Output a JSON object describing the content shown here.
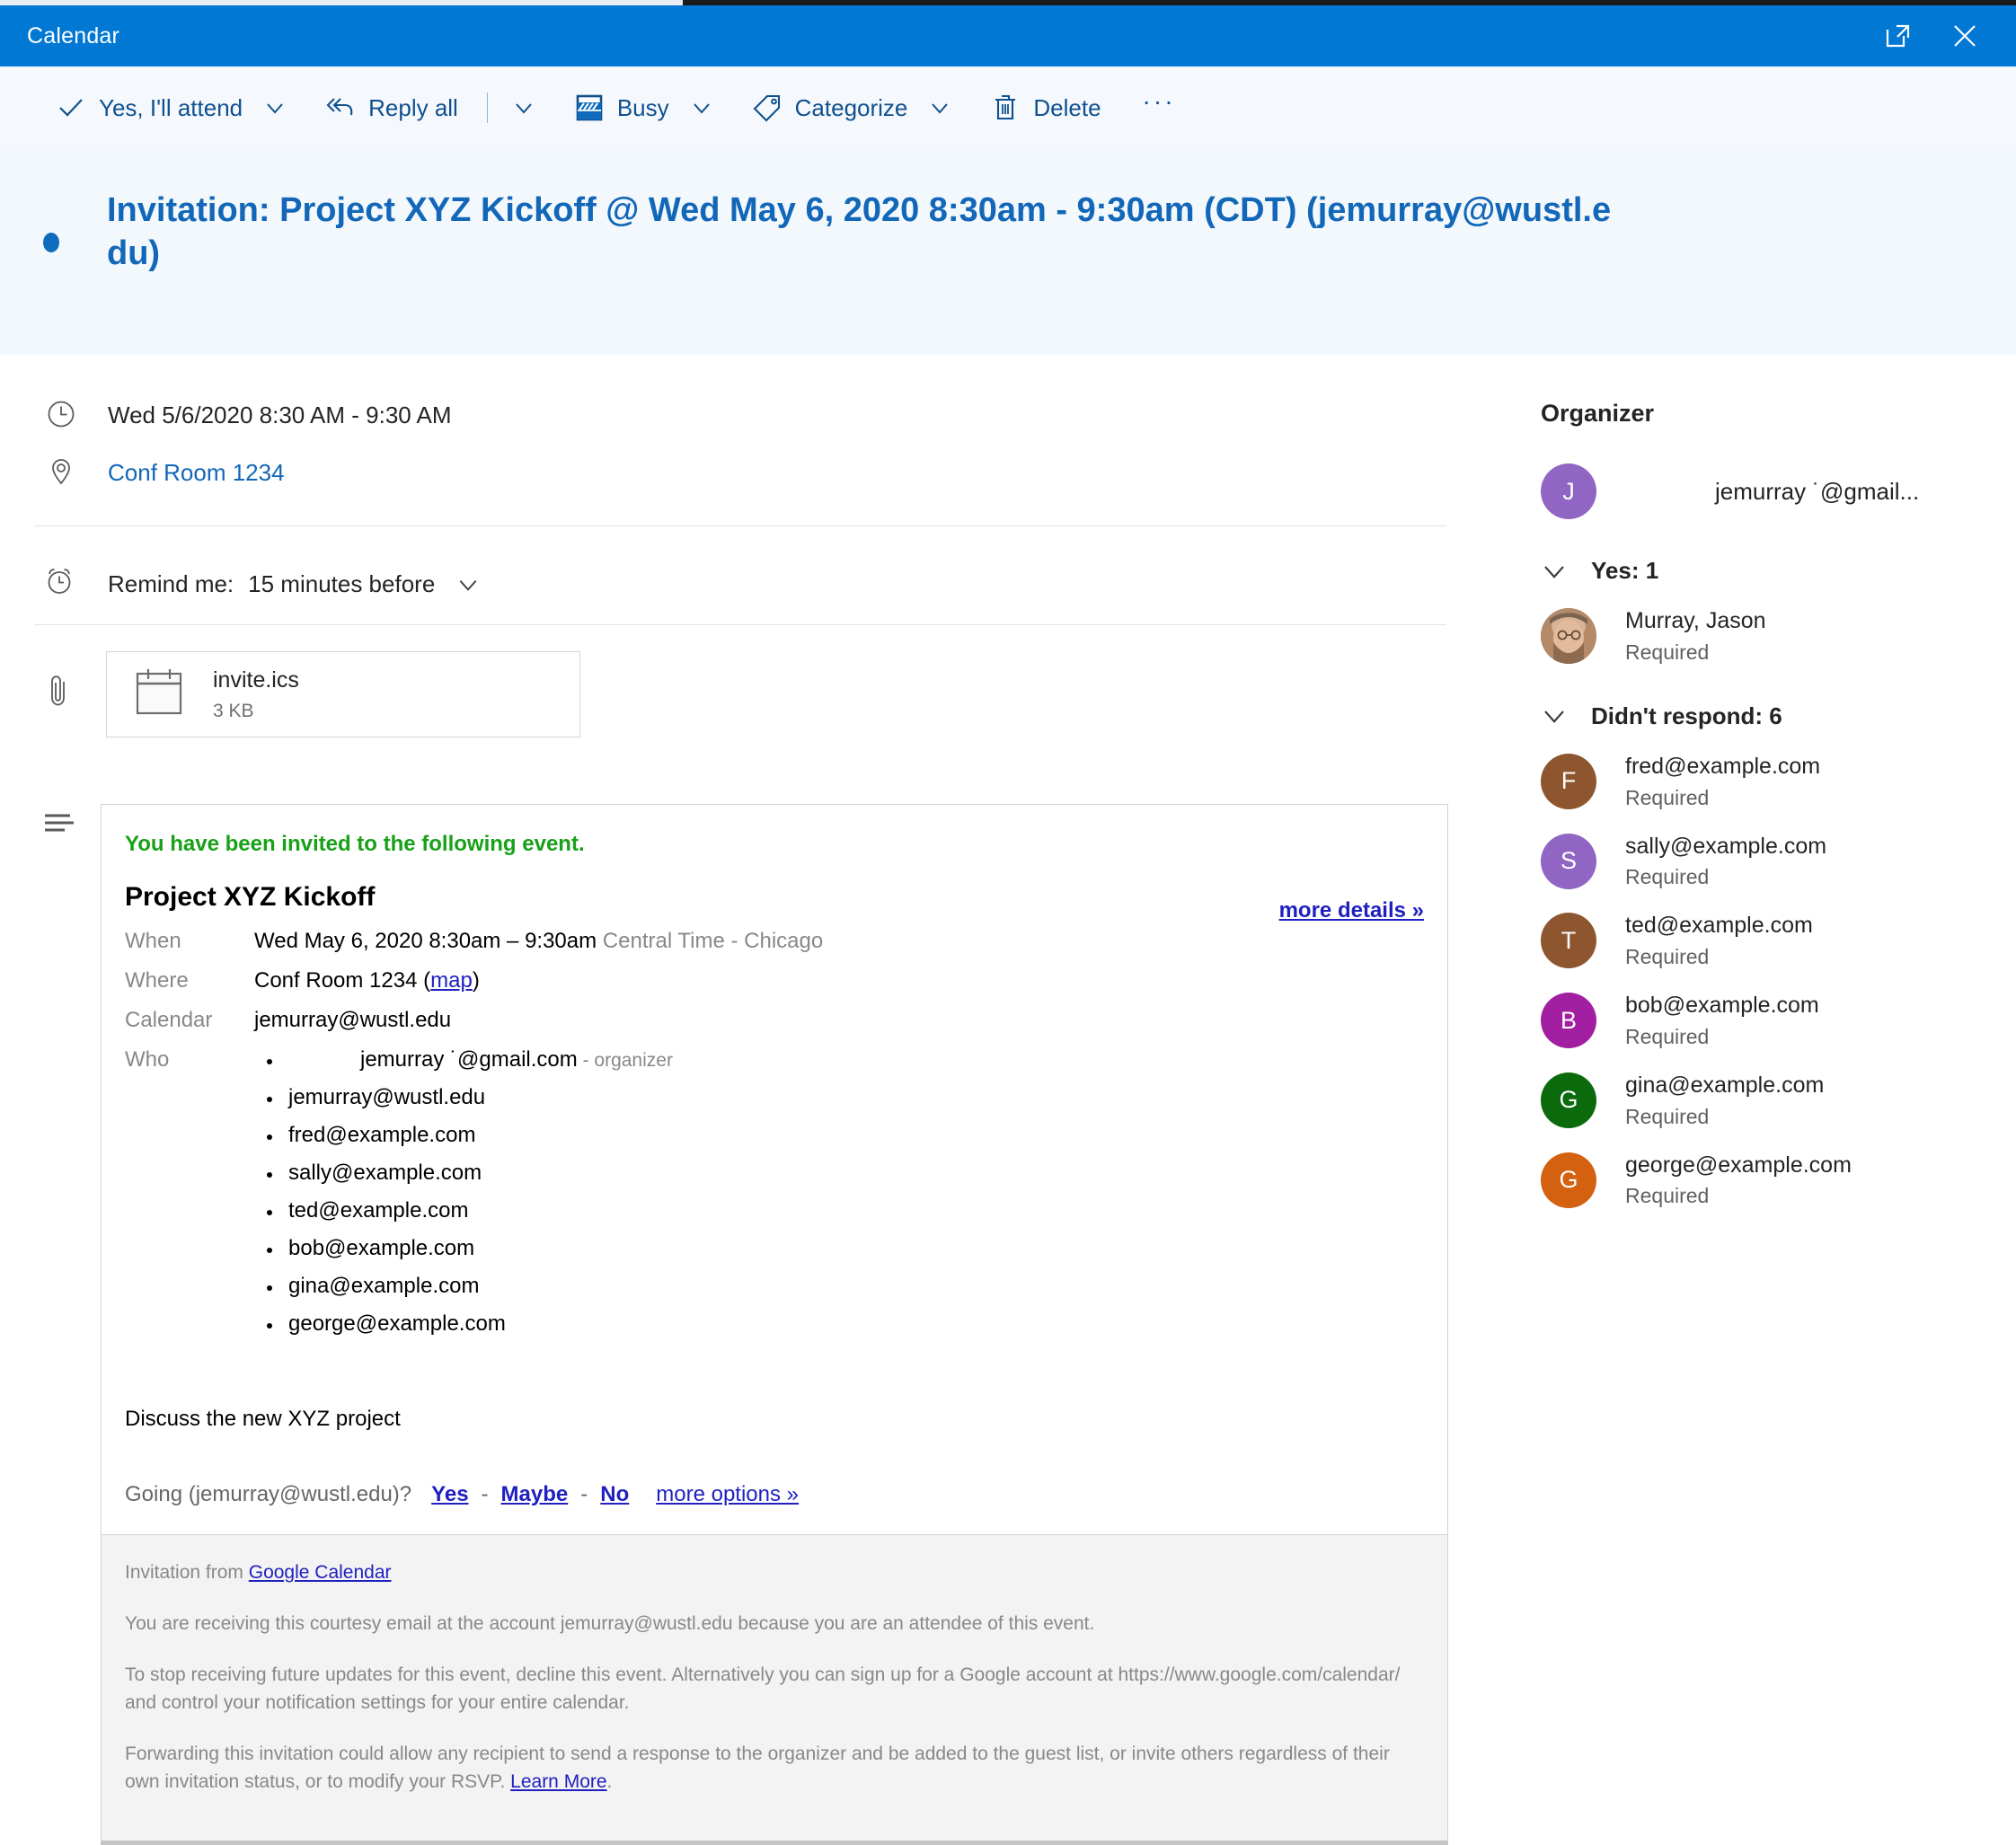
{
  "window": {
    "title": "Calendar",
    "actions": [
      {
        "name": "popout-icon",
        "label": "Open in new window"
      },
      {
        "name": "close-icon",
        "label": "Close"
      }
    ]
  },
  "toolbar": {
    "items": [
      {
        "icon": "checkmark-icon",
        "label": "Yes, I'll attend",
        "caret": true
      },
      {
        "icon": "reply-all-icon",
        "label": "Reply all",
        "caret": true,
        "separator": true
      },
      {
        "icon": "busy-icon",
        "label": "Busy",
        "caret": true
      },
      {
        "icon": "tag-icon",
        "label": "Categorize",
        "caret": true
      },
      {
        "icon": "trash-icon",
        "label": "Delete",
        "caret": false
      }
    ],
    "overflow_label": "···"
  },
  "subject": "Invitation: Project XYZ Kickoff @ Wed May 6, 2020 8:30am - 9:30am (CDT) (jemurray@wustl.edu)",
  "event": {
    "when": "Wed 5/6/2020 8:30 AM - 9:30 AM",
    "where": "Conf Room 1234",
    "reminder_label": "Remind me:",
    "reminder_value": "15 minutes before"
  },
  "attachment": {
    "name": "invite.ics",
    "size": "3 KB",
    "icon": "calendar-file-icon"
  },
  "invitation": {
    "banner": "You have been invited to the following event.",
    "title": "Project XYZ Kickoff",
    "more_details": "more details »",
    "rows": {
      "when_label": "When",
      "when_value": "Wed May 6, 2020 8:30am – 9:30am",
      "when_timezone": "Central Time - Chicago",
      "where_label": "Where",
      "where_value": "Conf Room 1234",
      "where_map": "map",
      "calendar_label": "Calendar",
      "calendar_value": "jemurray@wustl.edu",
      "who_label": "Who"
    },
    "who": [
      {
        "email": "jemurray ˙@gmail.com",
        "tag": "- organizer",
        "organizer": true
      },
      {
        "email": "jemurray@wustl.edu",
        "tag": "",
        "organizer": false
      },
      {
        "email": "fred@example.com",
        "tag": "",
        "organizer": false
      },
      {
        "email": "sally@example.com",
        "tag": "",
        "organizer": false
      },
      {
        "email": "ted@example.com",
        "tag": "",
        "organizer": false
      },
      {
        "email": "bob@example.com",
        "tag": "",
        "organizer": false
      },
      {
        "email": "gina@example.com",
        "tag": "",
        "organizer": false
      },
      {
        "email": "george@example.com",
        "tag": "",
        "organizer": false
      }
    ],
    "description": "Discuss the new XYZ project",
    "rsvp": {
      "prompt": "Going (jemurray@wustl.edu)?",
      "yes": "Yes",
      "maybe": "Maybe",
      "no": "No",
      "separator": "-",
      "more_options": "more options »"
    },
    "footer": {
      "from_prefix": "Invitation from ",
      "from_link": "Google Calendar",
      "courtesy": "You are receiving this courtesy email at the account jemurray@wustl.edu because you are an attendee of this event.",
      "stop": "To stop receiving future updates for this event, decline this event. Alternatively you can sign up for a Google account at https://www.google.com/calendar/ and control your notification settings for your entire calendar.",
      "forwarding_prefix": "Forwarding this invitation could allow any recipient to send a response to the organizer and be added to the guest list, or invite others regardless of their own invitation status, or to modify your RSVP. ",
      "forwarding_link": "Learn More",
      "forwarding_suffix": "."
    }
  },
  "sidebar": {
    "title": "Organizer",
    "organizer": {
      "initial": "J",
      "color": "#9065c4",
      "email": "jemurray ˙@gmail..."
    },
    "groups": [
      {
        "label": "Yes: 1",
        "expanded": true,
        "people": [
          {
            "initial": "J",
            "color": "#8a6a52",
            "photo": true,
            "name": "Murray, Jason",
            "role": "Required"
          }
        ]
      },
      {
        "label": "Didn't respond: 6",
        "expanded": true,
        "people": [
          {
            "initial": "F",
            "color": "#8e562e",
            "photo": false,
            "name": "fred@example.com",
            "role": "Required"
          },
          {
            "initial": "S",
            "color": "#9065c4",
            "photo": false,
            "name": "sally@example.com",
            "role": "Required"
          },
          {
            "initial": "T",
            "color": "#8e562e",
            "photo": false,
            "name": "ted@example.com",
            "role": "Required"
          },
          {
            "initial": "B",
            "color": "#a21fa2",
            "photo": false,
            "name": "bob@example.com",
            "role": "Required"
          },
          {
            "initial": "G",
            "color": "#0b6a0b",
            "photo": false,
            "name": "gina@example.com",
            "role": "Required"
          },
          {
            "initial": "G",
            "color": "#d4610f",
            "photo": false,
            "name": "george@example.com",
            "role": "Required"
          }
        ]
      }
    ]
  },
  "colors": {
    "brand_blue": "#0078d4",
    "toolbar_text": "#10508f",
    "subject_blue": "#1267b8",
    "link_purple_blue": "#2020c0",
    "invited_green": "#17a117"
  }
}
